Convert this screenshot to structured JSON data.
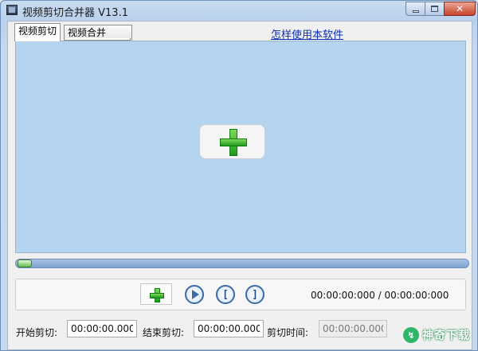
{
  "window": {
    "title": "视频剪切合并器 V13.1",
    "close_glyph": "✕"
  },
  "tabs": [
    {
      "label": "视频剪切",
      "active": true
    },
    {
      "label": "视频合并",
      "active": false
    }
  ],
  "help_link": "怎样使用本软件",
  "timeline": {
    "position": 0.0
  },
  "controls": {
    "mark_in_glyph": "[",
    "mark_out_glyph": "]",
    "time_readout": "00:00:00:000 / 00:00:00:000"
  },
  "cut_fields": {
    "start_label": "开始剪切:",
    "start_value": "00:00:00.000",
    "end_label": "结束剪切:",
    "end_value": "00:00:00.000",
    "duration_label": "剪切时间:",
    "duration_value": "00:00:00.000"
  },
  "watermark": {
    "text": "神奇下载"
  },
  "colors": {
    "preview_bg": "#b5d4ef",
    "accent_green": "#1f9a1d",
    "link_blue": "#0b2db6"
  },
  "icons": {
    "app": "film-icon",
    "add": "plus-icon",
    "play": "play-icon",
    "mark_in": "bracket-left-icon",
    "mark_out": "bracket-right-icon"
  }
}
